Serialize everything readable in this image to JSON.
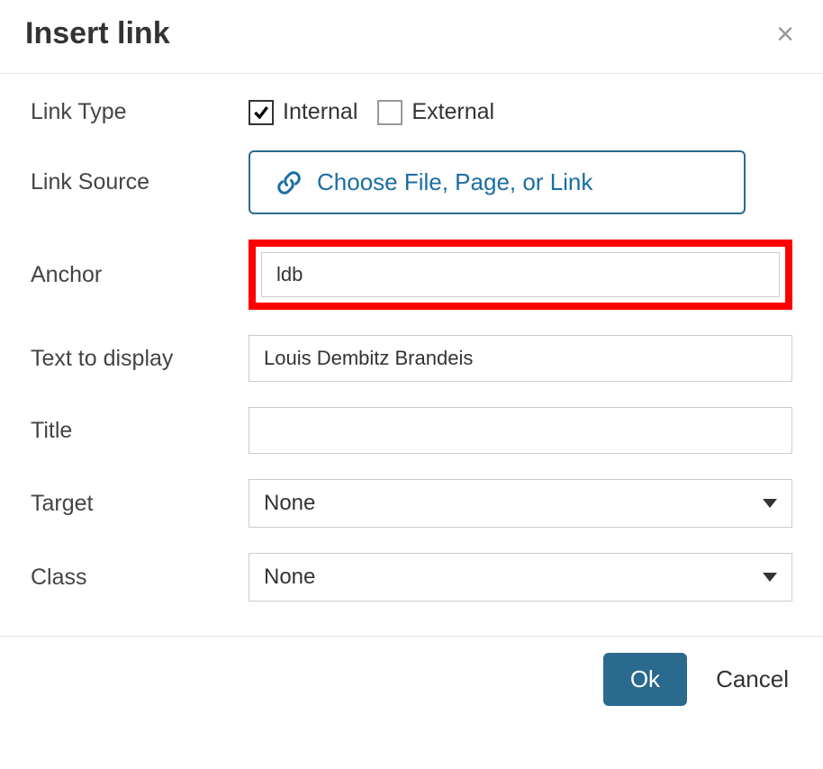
{
  "dialog": {
    "title": "Insert link",
    "close_label": "×"
  },
  "fields": {
    "link_type": {
      "label": "Link Type",
      "options": {
        "internal": {
          "label": "Internal",
          "checked": true
        },
        "external": {
          "label": "External",
          "checked": false
        }
      }
    },
    "link_source": {
      "label": "Link Source",
      "button_label": "Choose File, Page, or Link"
    },
    "anchor": {
      "label": "Anchor",
      "value": "ldb",
      "highlighted": true
    },
    "text_to_display": {
      "label": "Text to display",
      "value": "Louis Dembitz Brandeis"
    },
    "title": {
      "label": "Title",
      "value": ""
    },
    "target": {
      "label": "Target",
      "value": "None"
    },
    "klass": {
      "label": "Class",
      "value": "None"
    }
  },
  "footer": {
    "ok_label": "Ok",
    "cancel_label": "Cancel"
  }
}
